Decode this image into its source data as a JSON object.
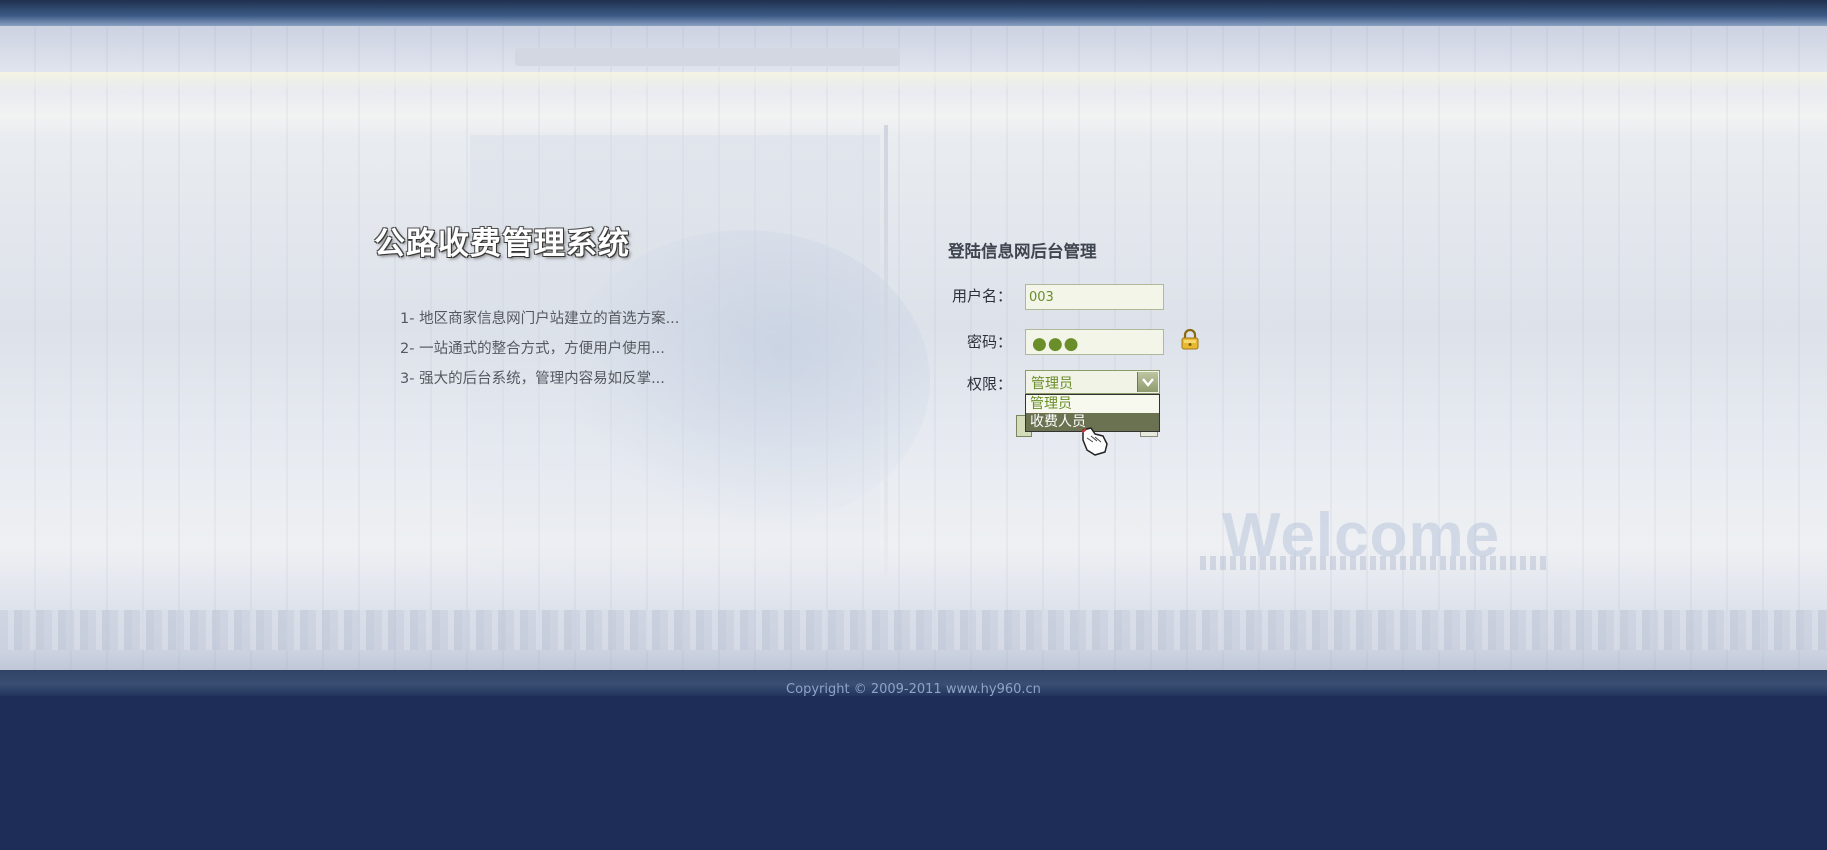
{
  "app": {
    "title": "公路收费管理系统",
    "features": [
      "1- 地区商家信息网门户站建立的首选方案...",
      "2- 一站通式的整合方式，方便用户使用...",
      "3- 强大的后台系统，管理内容易如反掌..."
    ]
  },
  "login": {
    "title": "登陆信息网后台管理",
    "username_label": "用户名：",
    "username_value": "003",
    "password_label": "密码：",
    "password_mask": "●●●",
    "role_label": "权限：",
    "role_selected": "管理员",
    "role_options": [
      "管理员",
      "收费人员"
    ]
  },
  "welcome": "Welcome",
  "footer": {
    "copyright": "Copyright © 2009-2011 www.hy960.cn"
  },
  "icons": {
    "lock": "lock-icon",
    "cursor": "hand-pointer-icon",
    "dropdown": "chevron-down-icon"
  },
  "colors": {
    "field_text": "#6a8e2a",
    "page_bg": "#1e2c58",
    "title_shadow": "#333333"
  }
}
